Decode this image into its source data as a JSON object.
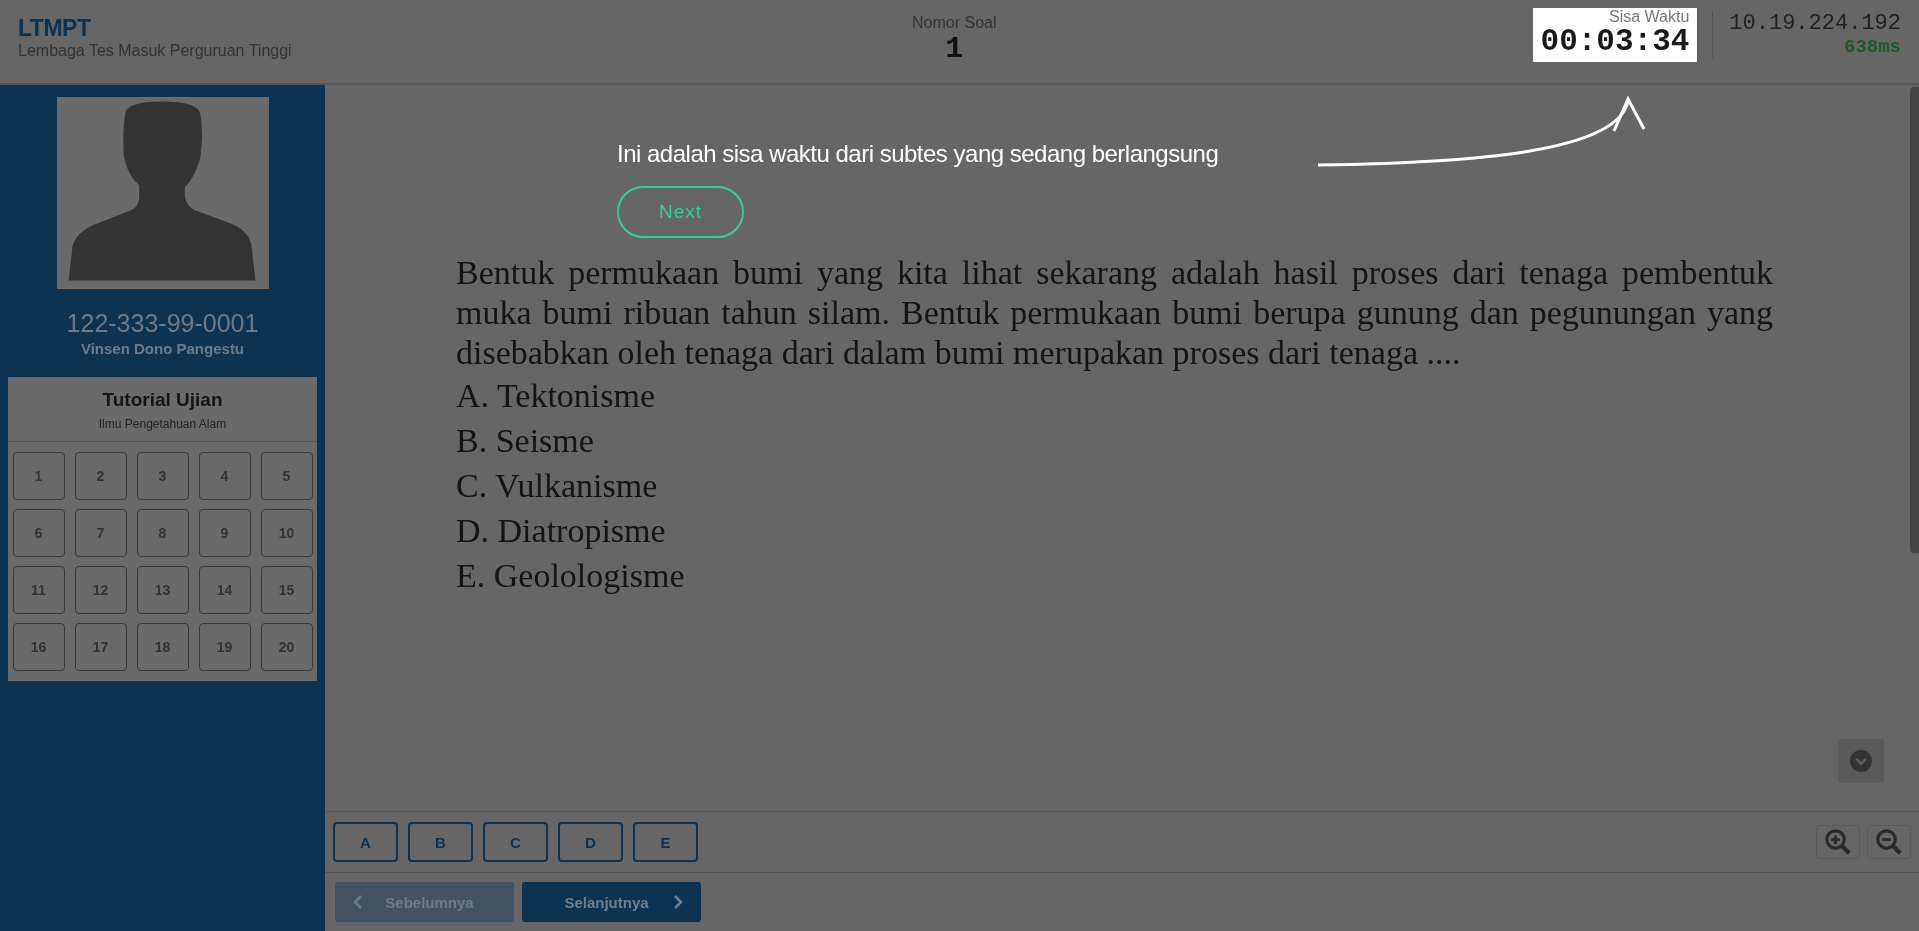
{
  "header": {
    "logo": "LTMPT",
    "subtitle": "Lembaga Tes Masuk Perguruan Tinggi"
  },
  "question_number": {
    "label": "Nomor Soal",
    "value": "1"
  },
  "timer": {
    "label": "Sisa Waktu",
    "value": "00:03:34"
  },
  "connection": {
    "ip": "10.19.224.192",
    "latency": "638ms"
  },
  "sidebar": {
    "participant_id": "122-333-99-0001",
    "participant_name": "Vinsen Dono Pangestu",
    "panel_title": "Tutorial Ujian",
    "panel_subtitle": "Ilmu Pengetahuan Alam",
    "question_buttons": [
      "1",
      "2",
      "3",
      "4",
      "5",
      "6",
      "7",
      "8",
      "9",
      "10",
      "11",
      "12",
      "13",
      "14",
      "15",
      "16",
      "17",
      "18",
      "19",
      "20"
    ]
  },
  "question": {
    "text": "Bentuk permukaan bumi yang kita lihat sekarang adalah hasil proses dari tenaga pembentuk muka bumi ribuan tahun silam. Bentuk permukaan bumi berupa gunung dan pegunungan yang disebabkan oleh tenaga dari dalam bumi merupakan proses dari tenaga ....",
    "options": [
      "A. Tektonisme",
      "B. Seisme",
      "C. Vulkanisme",
      "D. Diatropisme",
      "E. Geolologisme"
    ]
  },
  "answer_buttons": [
    "A",
    "B",
    "C",
    "D",
    "E"
  ],
  "navigation": {
    "previous": {
      "label": "Sebelumnya",
      "disabled": true
    },
    "next": {
      "label": "Selanjutnya",
      "disabled": false
    }
  },
  "tutorial": {
    "message": "Ini adalah sisa waktu dari subtes yang sedang berlangsung",
    "next_button": "Next"
  }
}
